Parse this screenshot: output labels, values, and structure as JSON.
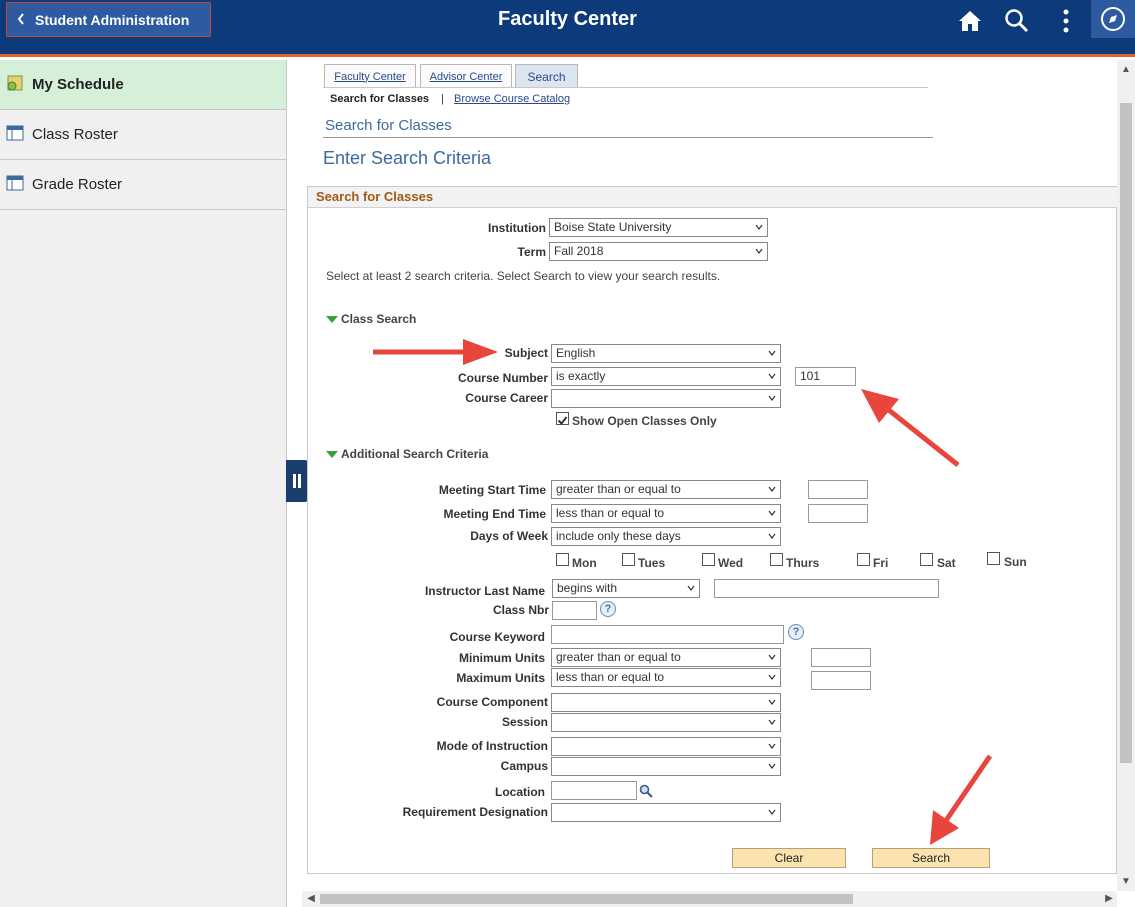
{
  "header": {
    "back_label": "Student Administration",
    "title": "Faculty Center"
  },
  "sidebar": {
    "items": [
      {
        "label": "My Schedule"
      },
      {
        "label": "Class Roster"
      },
      {
        "label": "Grade Roster"
      }
    ]
  },
  "tabs": [
    {
      "label": "Faculty Center"
    },
    {
      "label": "Advisor Center"
    },
    {
      "label": "Search"
    }
  ],
  "subnav": {
    "current": "Search for Classes",
    "separator": "|",
    "link": "Browse Course Catalog"
  },
  "page": {
    "subtitle": "Search for Classes",
    "title": "Enter Search Criteria"
  },
  "group": {
    "title": "Search for Classes",
    "institution_label": "Institution",
    "institution_value": "Boise State University",
    "term_label": "Term",
    "term_value": "Fall 2018",
    "instructions": "Select at least 2 search criteria. Select Search to view your search results."
  },
  "class_search": {
    "header": "Class Search",
    "subject_label": "Subject",
    "subject_value": "English",
    "course_number_label": "Course Number",
    "course_number_op": "is exactly",
    "course_number_value": "101",
    "course_career_label": "Course Career",
    "course_career_value": "",
    "open_only_label": "Show Open Classes Only",
    "open_only_checked": true
  },
  "additional": {
    "header": "Additional Search Criteria",
    "meeting_start_label": "Meeting Start Time",
    "meeting_start_op": "greater than or equal to",
    "meeting_end_label": "Meeting End Time",
    "meeting_end_op": "less than or equal to",
    "days_label": "Days of Week",
    "days_op": "include only these days",
    "days": [
      "Mon",
      "Tues",
      "Wed",
      "Thurs",
      "Fri",
      "Sat",
      "Sun"
    ],
    "instructor_label": "Instructor Last Name",
    "instructor_op": "begins with",
    "class_nbr_label": "Class Nbr",
    "keyword_label": "Course Keyword",
    "min_units_label": "Minimum Units",
    "min_units_op": "greater than or equal to",
    "max_units_label": "Maximum Units",
    "max_units_op": "less than or equal to",
    "component_label": "Course Component",
    "session_label": "Session",
    "mode_label": "Mode of Instruction",
    "campus_label": "Campus",
    "location_label": "Location",
    "requirement_label": "Requirement Designation"
  },
  "buttons": {
    "clear": "Clear",
    "search": "Search",
    "help": "?"
  },
  "colors": {
    "header_bg": "#0c3a7a",
    "header_accent": "#e0652a",
    "annotation_arrow": "#e8453c",
    "active_sidebar": "#d5efd9",
    "button_bg": "#fbe3b0"
  }
}
